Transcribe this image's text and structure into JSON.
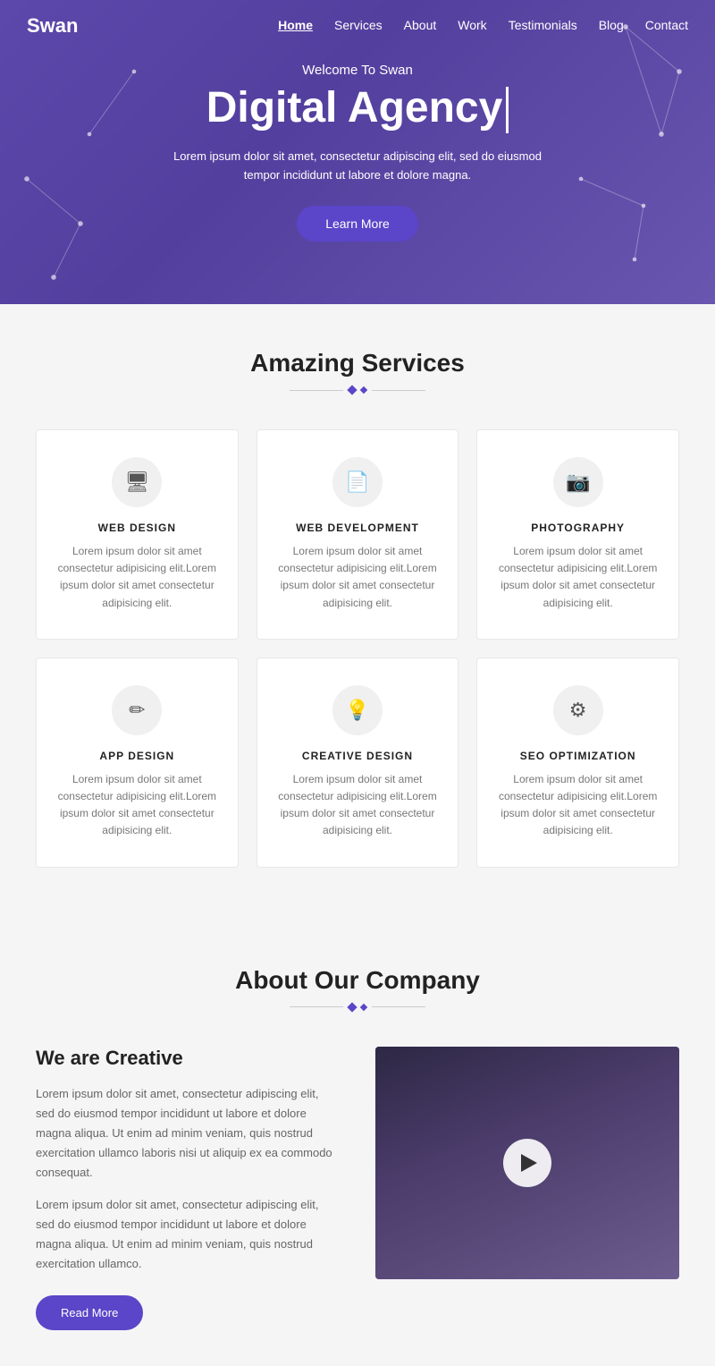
{
  "logo": "Swan",
  "nav": {
    "items": [
      {
        "label": "Home",
        "active": true
      },
      {
        "label": "Services",
        "active": false
      },
      {
        "label": "About",
        "active": false
      },
      {
        "label": "Work",
        "active": false
      },
      {
        "label": "Testimonials",
        "active": false
      },
      {
        "label": "Blog",
        "active": false
      },
      {
        "label": "Contact",
        "active": false
      }
    ]
  },
  "hero": {
    "welcome": "Welcome To Swan",
    "title": "Digital Agency",
    "description": "Lorem ipsum dolor sit amet, consectetur adipiscing elit, sed do eiusmod tempor incididunt ut labore et dolore magna.",
    "cta_label": "Learn More"
  },
  "services": {
    "title": "Amazing Services",
    "items": [
      {
        "icon": "🖥",
        "title": "WEB DESIGN",
        "desc": "Lorem ipsum dolor sit amet consectetur adipisicing elit.Lorem ipsum dolor sit amet consectetur adipisicing elit."
      },
      {
        "icon": "📄",
        "title": "WEB DEVELOPMENT",
        "desc": "Lorem ipsum dolor sit amet consectetur adipisicing elit.Lorem ipsum dolor sit amet consectetur adipisicing elit."
      },
      {
        "icon": "📷",
        "title": "PHOTOGRAPHY",
        "desc": "Lorem ipsum dolor sit amet consectetur adipisicing elit.Lorem ipsum dolor sit amet consectetur adipisicing elit."
      },
      {
        "icon": "✏",
        "title": "APP DESIGN",
        "desc": "Lorem ipsum dolor sit amet consectetur adipisicing elit.Lorem ipsum dolor sit amet consectetur adipisicing elit."
      },
      {
        "icon": "💡",
        "title": "CREATIVE DESIGN",
        "desc": "Lorem ipsum dolor sit amet consectetur adipisicing elit.Lorem ipsum dolor sit amet consectetur adipisicing elit."
      },
      {
        "icon": "⚙",
        "title": "SEO OPTIMIZATION",
        "desc": "Lorem ipsum dolor sit amet consectetur adipisicing elit.Lorem ipsum dolor sit amet consectetur adipisicing elit."
      }
    ]
  },
  "about": {
    "title": "About Our Company",
    "heading": "We are Creative",
    "para1": "Lorem ipsum dolor sit amet, consectetur adipiscing elit, sed do eiusmod tempor incididunt ut labore et dolore magna aliqua. Ut enim ad minim veniam, quis nostrud exercitation ullamco laboris nisi ut aliquip ex ea commodo consequat.",
    "para2": "Lorem ipsum dolor sit amet, consectetur adipiscing elit, sed do eiusmod tempor incididunt ut labore et dolore magna aliqua. Ut enim ad minim veniam, quis nostrud exercitation ullamco.",
    "cta_label": "Read More"
  }
}
